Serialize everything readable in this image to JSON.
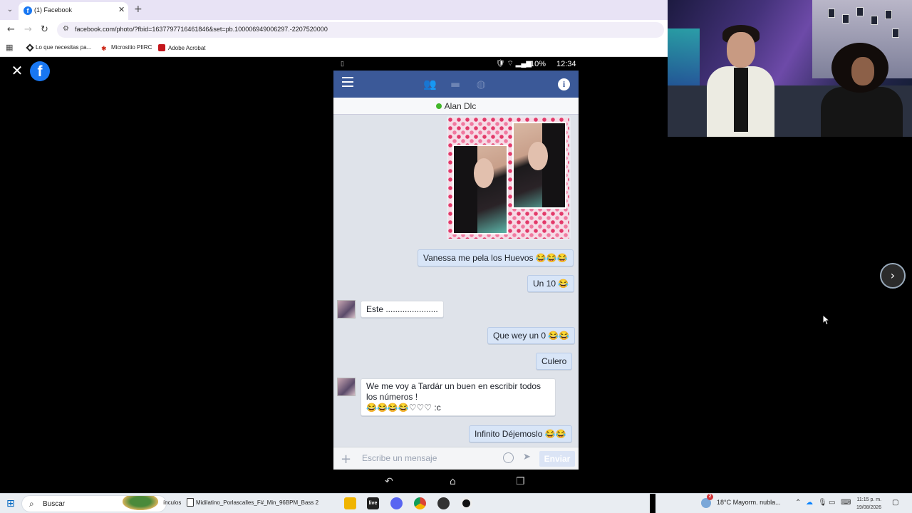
{
  "browser": {
    "tab_title": "(1) Facebook",
    "tab_favicon": "f",
    "url": "facebook.com/photo/?fbid=1637797716461846&set=pb.100006949006297.-2207520000",
    "bookmarks": [
      {
        "label": "Lo que necesitas pa..."
      },
      {
        "label": "Micrositio PIIRC"
      },
      {
        "label": "Adobe Acrobat"
      }
    ]
  },
  "viewer": {
    "close_icon": "close-icon",
    "logo_letter": "f",
    "next_icon": "chevron-right-icon"
  },
  "phone": {
    "status": {
      "battery": "10%",
      "time": "12:34"
    },
    "contact_name": "Alan Dlc",
    "messages": [
      {
        "dir": "out",
        "text": "Vanessa me pela los Huevos 😂😂😂"
      },
      {
        "dir": "out",
        "text": "Un 10 😂"
      },
      {
        "dir": "in",
        "text": "Este ......................"
      },
      {
        "dir": "out",
        "text": "Que wey un 0 😂😂"
      },
      {
        "dir": "out",
        "text": "Culero"
      },
      {
        "dir": "in",
        "text": "We me voy a Tardár un buen en escribir todos los números !",
        "text2": "😂😂😂😂♡♡♡ :c"
      },
      {
        "dir": "out",
        "text": "Infinito Déjemoslo 😂😂"
      }
    ],
    "composer": {
      "placeholder": "Escribe un mensaje",
      "send_label": "Enviar"
    }
  },
  "taskbar": {
    "search_label": "Buscar",
    "partial_label": "ínculos",
    "window_title": "Midilatino_Porlascalles_F#_Min_96BPM_Bass 2",
    "weather": "18°C  Mayorm. nubla...",
    "weather_badge": "2",
    "clock_time": "11:15 p. m.",
    "clock_date": "19/08/2026",
    "accent": "#0067c0"
  },
  "colors": {
    "facebook_blue": "#1877f2",
    "messenger_bar": "#3b5998",
    "outgoing_bubble": "#d8e5f7"
  }
}
